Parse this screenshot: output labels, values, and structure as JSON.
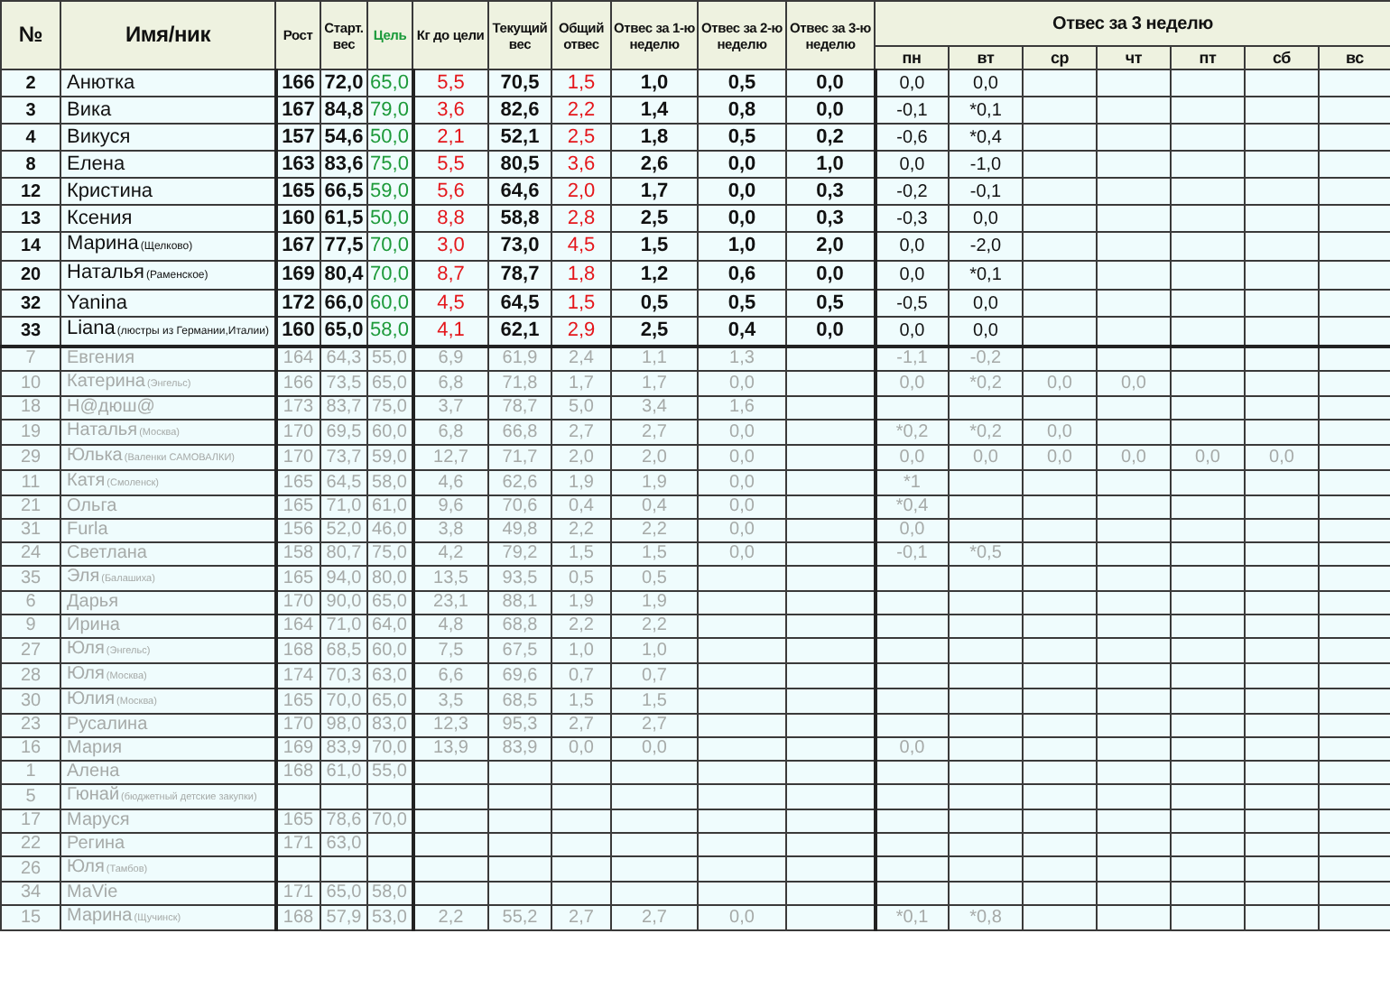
{
  "table": {
    "columns": [
      {
        "label": "№",
        "kind": "index"
      },
      {
        "label": "Имя/ник",
        "kind": "name"
      },
      {
        "label": "Рост",
        "kind": "num"
      },
      {
        "label": "Старт. вес",
        "kind": "num"
      },
      {
        "label": "Цель",
        "kind": "goal"
      },
      {
        "label": "Кг до цели",
        "kind": "alert"
      },
      {
        "label": "Текущий вес",
        "kind": "num"
      },
      {
        "label": "Общий отвес",
        "kind": "alert"
      },
      {
        "label": "Отвес за 1-ю неделю",
        "kind": "num"
      },
      {
        "label": "Отвес за 2-ю неделю",
        "kind": "num"
      },
      {
        "label": "Отвес за 3-ю неделю",
        "kind": "num"
      }
    ],
    "week_group": {
      "label": "Отвес за 3 неделю",
      "days": [
        "пн",
        "вт",
        "ср",
        "чт",
        "пт",
        "сб",
        "вс"
      ]
    },
    "rows": [
      {
        "active": true,
        "no": "2",
        "name": "Анютка",
        "cells": [
          "166",
          "72,0",
          "65,0",
          "5,5",
          "70,5",
          "1,5",
          "1,0",
          "0,5",
          "0,0"
        ],
        "days": [
          "0,0",
          "0,0"
        ]
      },
      {
        "active": true,
        "no": "3",
        "name": "Вика",
        "cells": [
          "167",
          "84,8",
          "79,0",
          "3,6",
          "82,6",
          "2,2",
          "1,4",
          "0,8",
          "0,0"
        ],
        "days": [
          "-0,1",
          "*0,1"
        ]
      },
      {
        "active": true,
        "no": "4",
        "name": "Викуся",
        "cells": [
          "157",
          "54,6",
          "50,0",
          "2,1",
          "52,1",
          "2,5",
          "1,8",
          "0,5",
          "0,2"
        ],
        "days": [
          "-0,6",
          "*0,4"
        ]
      },
      {
        "active": true,
        "no": "8",
        "name": "Елена",
        "cells": [
          "163",
          "83,6",
          "75,0",
          "5,5",
          "80,5",
          "3,6",
          "2,6",
          "0,0",
          "1,0"
        ],
        "days": [
          "0,0",
          "-1,0"
        ]
      },
      {
        "active": true,
        "no": "12",
        "name": "Кристина",
        "cells": [
          "165",
          "66,5",
          "59,0",
          "5,6",
          "64,6",
          "2,0",
          "1,7",
          "0,0",
          "0,3"
        ],
        "days": [
          "-0,2",
          "-0,1"
        ]
      },
      {
        "active": true,
        "no": "13",
        "name": "Ксения",
        "cells": [
          "160",
          "61,5",
          "50,0",
          "8,8",
          "58,8",
          "2,8",
          "2,5",
          "0,0",
          "0,3"
        ],
        "days": [
          "-0,3",
          "0,0"
        ]
      },
      {
        "active": true,
        "no": "14",
        "name": "Марина",
        "note": "(Щелково)",
        "cells": [
          "167",
          "77,5",
          "70,0",
          "3,0",
          "73,0",
          "4,5",
          "1,5",
          "1,0",
          "2,0"
        ],
        "days": [
          "0,0",
          "-2,0"
        ]
      },
      {
        "active": true,
        "no": "20",
        "name": "Наталья",
        "note": "(Раменское)",
        "cells": [
          "169",
          "80,4",
          "70,0",
          "8,7",
          "78,7",
          "1,8",
          "1,2",
          "0,6",
          "0,0"
        ],
        "days": [
          "0,0",
          "*0,1"
        ]
      },
      {
        "active": true,
        "no": "32",
        "name": "Yanina",
        "cells": [
          "172",
          "66,0",
          "60,0",
          "4,5",
          "64,5",
          "1,5",
          "0,5",
          "0,5",
          "0,5"
        ],
        "days": [
          "-0,5",
          "0,0"
        ]
      },
      {
        "active": true,
        "no": "33",
        "name": "Liana",
        "note": "(люстры из Германии,Италии)",
        "cells": [
          "160",
          "65,0",
          "58,0",
          "4,1",
          "62,1",
          "2,9",
          "2,5",
          "0,4",
          "0,0"
        ],
        "days": [
          "0,0",
          "0,0"
        ]
      },
      {
        "active": false,
        "no": "7",
        "name": "Евгения",
        "cells": [
          "164",
          "64,3",
          "55,0",
          "6,9",
          "61,9",
          "2,4",
          "1,1",
          "1,3"
        ],
        "days": [
          "-1,1",
          "-0,2"
        ]
      },
      {
        "active": false,
        "no": "10",
        "name": "Катерина",
        "note": "(Энгельс)",
        "cells": [
          "166",
          "73,5",
          "65,0",
          "6,8",
          "71,8",
          "1,7",
          "1,7",
          "0,0"
        ],
        "days": [
          "0,0",
          "*0,2",
          "0,0",
          "0,0"
        ]
      },
      {
        "active": false,
        "no": "18",
        "name": "Н@дюш@",
        "cells": [
          "173",
          "83,7",
          "75,0",
          "3,7",
          "78,7",
          "5,0",
          "3,4",
          "1,6"
        ]
      },
      {
        "active": false,
        "no": "19",
        "name": "Наталья",
        "note": "(Москва)",
        "cells": [
          "170",
          "69,5",
          "60,0",
          "6,8",
          "66,8",
          "2,7",
          "2,7",
          "0,0"
        ],
        "days": [
          "*0,2",
          "*0,2",
          "0,0"
        ]
      },
      {
        "active": false,
        "no": "29",
        "name": "Юлька",
        "note": "(Валенки САМОВАЛКИ)",
        "cells": [
          "170",
          "73,7",
          "59,0",
          "12,7",
          "71,7",
          "2,0",
          "2,0",
          "0,0"
        ],
        "days": [
          "0,0",
          "0,0",
          "0,0",
          "0,0",
          "0,0",
          "0,0"
        ]
      },
      {
        "active": false,
        "no": "11",
        "name": "Катя",
        "note": "(Смоленск)",
        "cells": [
          "165",
          "64,5",
          "58,0",
          "4,6",
          "62,6",
          "1,9",
          "1,9",
          "0,0"
        ],
        "days": [
          "*1"
        ]
      },
      {
        "active": false,
        "no": "21",
        "name": "Ольга",
        "cells": [
          "165",
          "71,0",
          "61,0",
          "9,6",
          "70,6",
          "0,4",
          "0,4",
          "0,0"
        ],
        "days": [
          "*0,4"
        ]
      },
      {
        "active": false,
        "no": "31",
        "name": "Furla",
        "cells": [
          "156",
          "52,0",
          "46,0",
          "3,8",
          "49,8",
          "2,2",
          "2,2",
          "0,0"
        ],
        "days": [
          "0,0"
        ]
      },
      {
        "active": false,
        "no": "24",
        "name": "Светлана",
        "cells": [
          "158",
          "80,7",
          "75,0",
          "4,2",
          "79,2",
          "1,5",
          "1,5",
          "0,0"
        ],
        "days": [
          "-0,1",
          "*0,5"
        ]
      },
      {
        "active": false,
        "no": "35",
        "name": "Эля",
        "note": "(Балашиха)",
        "cells": [
          "165",
          "94,0",
          "80,0",
          "13,5",
          "93,5",
          "0,5",
          "0,5"
        ]
      },
      {
        "active": false,
        "no": "6",
        "name": "Дарья",
        "cells": [
          "170",
          "90,0",
          "65,0",
          "23,1",
          "88,1",
          "1,9",
          "1,9"
        ]
      },
      {
        "active": false,
        "no": "9",
        "name": "Ирина",
        "cells": [
          "164",
          "71,0",
          "64,0",
          "4,8",
          "68,8",
          "2,2",
          "2,2"
        ]
      },
      {
        "active": false,
        "no": "27",
        "name": "Юля",
        "note": "(Энгельс)",
        "cells": [
          "168",
          "68,5",
          "60,0",
          "7,5",
          "67,5",
          "1,0",
          "1,0"
        ]
      },
      {
        "active": false,
        "no": "28",
        "name": "Юля",
        "note": "(Москва)",
        "cells": [
          "174",
          "70,3",
          "63,0",
          "6,6",
          "69,6",
          "0,7",
          "0,7"
        ]
      },
      {
        "active": false,
        "no": "30",
        "name": "Юлия",
        "note": "(Москва)",
        "cells": [
          "165",
          "70,0",
          "65,0",
          "3,5",
          "68,5",
          "1,5",
          "1,5"
        ]
      },
      {
        "active": false,
        "no": "23",
        "name": "Русалина",
        "cells": [
          "170",
          "98,0",
          "83,0",
          "12,3",
          "95,3",
          "2,7",
          "2,7"
        ]
      },
      {
        "active": false,
        "no": "16",
        "name": "Мария",
        "cells": [
          "169",
          "83,9",
          "70,0",
          "13,9",
          "83,9",
          "0,0",
          "0,0"
        ],
        "days": [
          "0,0"
        ]
      },
      {
        "active": false,
        "no": "1",
        "name": "Алена",
        "cells": [
          "168",
          "61,0",
          "55,0"
        ]
      },
      {
        "active": false,
        "no": "5",
        "name": "Гюнай",
        "note": "(бюджетный детские закупки)"
      },
      {
        "active": false,
        "no": "17",
        "name": "Маруся",
        "cells": [
          "165",
          "78,6",
          "70,0"
        ]
      },
      {
        "active": false,
        "no": "22",
        "name": "Регина",
        "cells": [
          "171",
          "63,0"
        ]
      },
      {
        "active": false,
        "no": "26",
        "name": "Юля",
        "note": "(Тамбов)"
      },
      {
        "active": false,
        "no": "34",
        "name": "MaVie",
        "cells": [
          "171",
          "65,0",
          "58,0"
        ]
      },
      {
        "active": false,
        "no": "15",
        "name": "Марина",
        "note": "(Щучинск)",
        "cells": [
          "168",
          "57,9",
          "53,0",
          "2,2",
          "55,2",
          "2,7",
          "2,7",
          "0,0"
        ],
        "days": [
          "*0,1",
          "*0,8"
        ]
      }
    ]
  }
}
